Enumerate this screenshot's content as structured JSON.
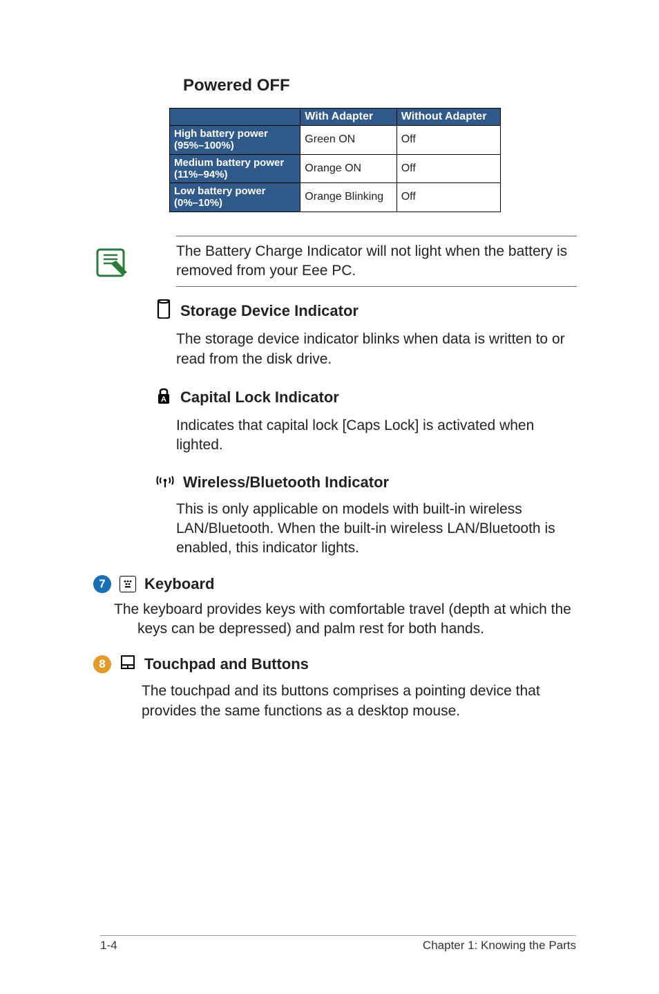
{
  "heading": "Powered OFF",
  "table": {
    "col1": "With Adapter",
    "col2": "Without Adapter",
    "rows": [
      {
        "label1": "High battery power",
        "label2": "(95%–100%)",
        "c1": "Green ON",
        "c2": "Off"
      },
      {
        "label1": "Medium battery power",
        "label2": "(11%–94%)",
        "c1": "Orange ON",
        "c2": "Off"
      },
      {
        "label1": "Low battery power",
        "label2": "(0%–10%)",
        "c1": "Orange Blinking",
        "c2": "Off"
      }
    ]
  },
  "note": "The Battery Charge Indicator will not light when the battery is removed from your Eee PC.",
  "indicators": {
    "storage": {
      "title": "Storage Device Indicator",
      "body": "The storage device indicator blinks when data is written to or read from the disk drive."
    },
    "caps": {
      "title": "Capital Lock Indicator",
      "body": "Indicates that capital lock [Caps Lock] is activated when lighted."
    },
    "wifi": {
      "title": "Wireless/Bluetooth Indicator",
      "body": "This is only applicable on models with built-in wireless LAN/Bluetooth. When the built-in wireless LAN/Bluetooth is enabled, this indicator lights."
    }
  },
  "keyboard": {
    "num": "7",
    "title": "Keyboard",
    "body": "The keyboard provides keys with comfortable travel (depth at which the keys can be depressed) and palm rest for both hands."
  },
  "touchpad": {
    "num": "8",
    "title": "Touchpad and Buttons",
    "body": "The touchpad and its buttons comprises a pointing device that provides the same functions as a desktop mouse."
  },
  "footer": {
    "left": "1-4",
    "right": "Chapter 1: Knowing the Parts"
  }
}
